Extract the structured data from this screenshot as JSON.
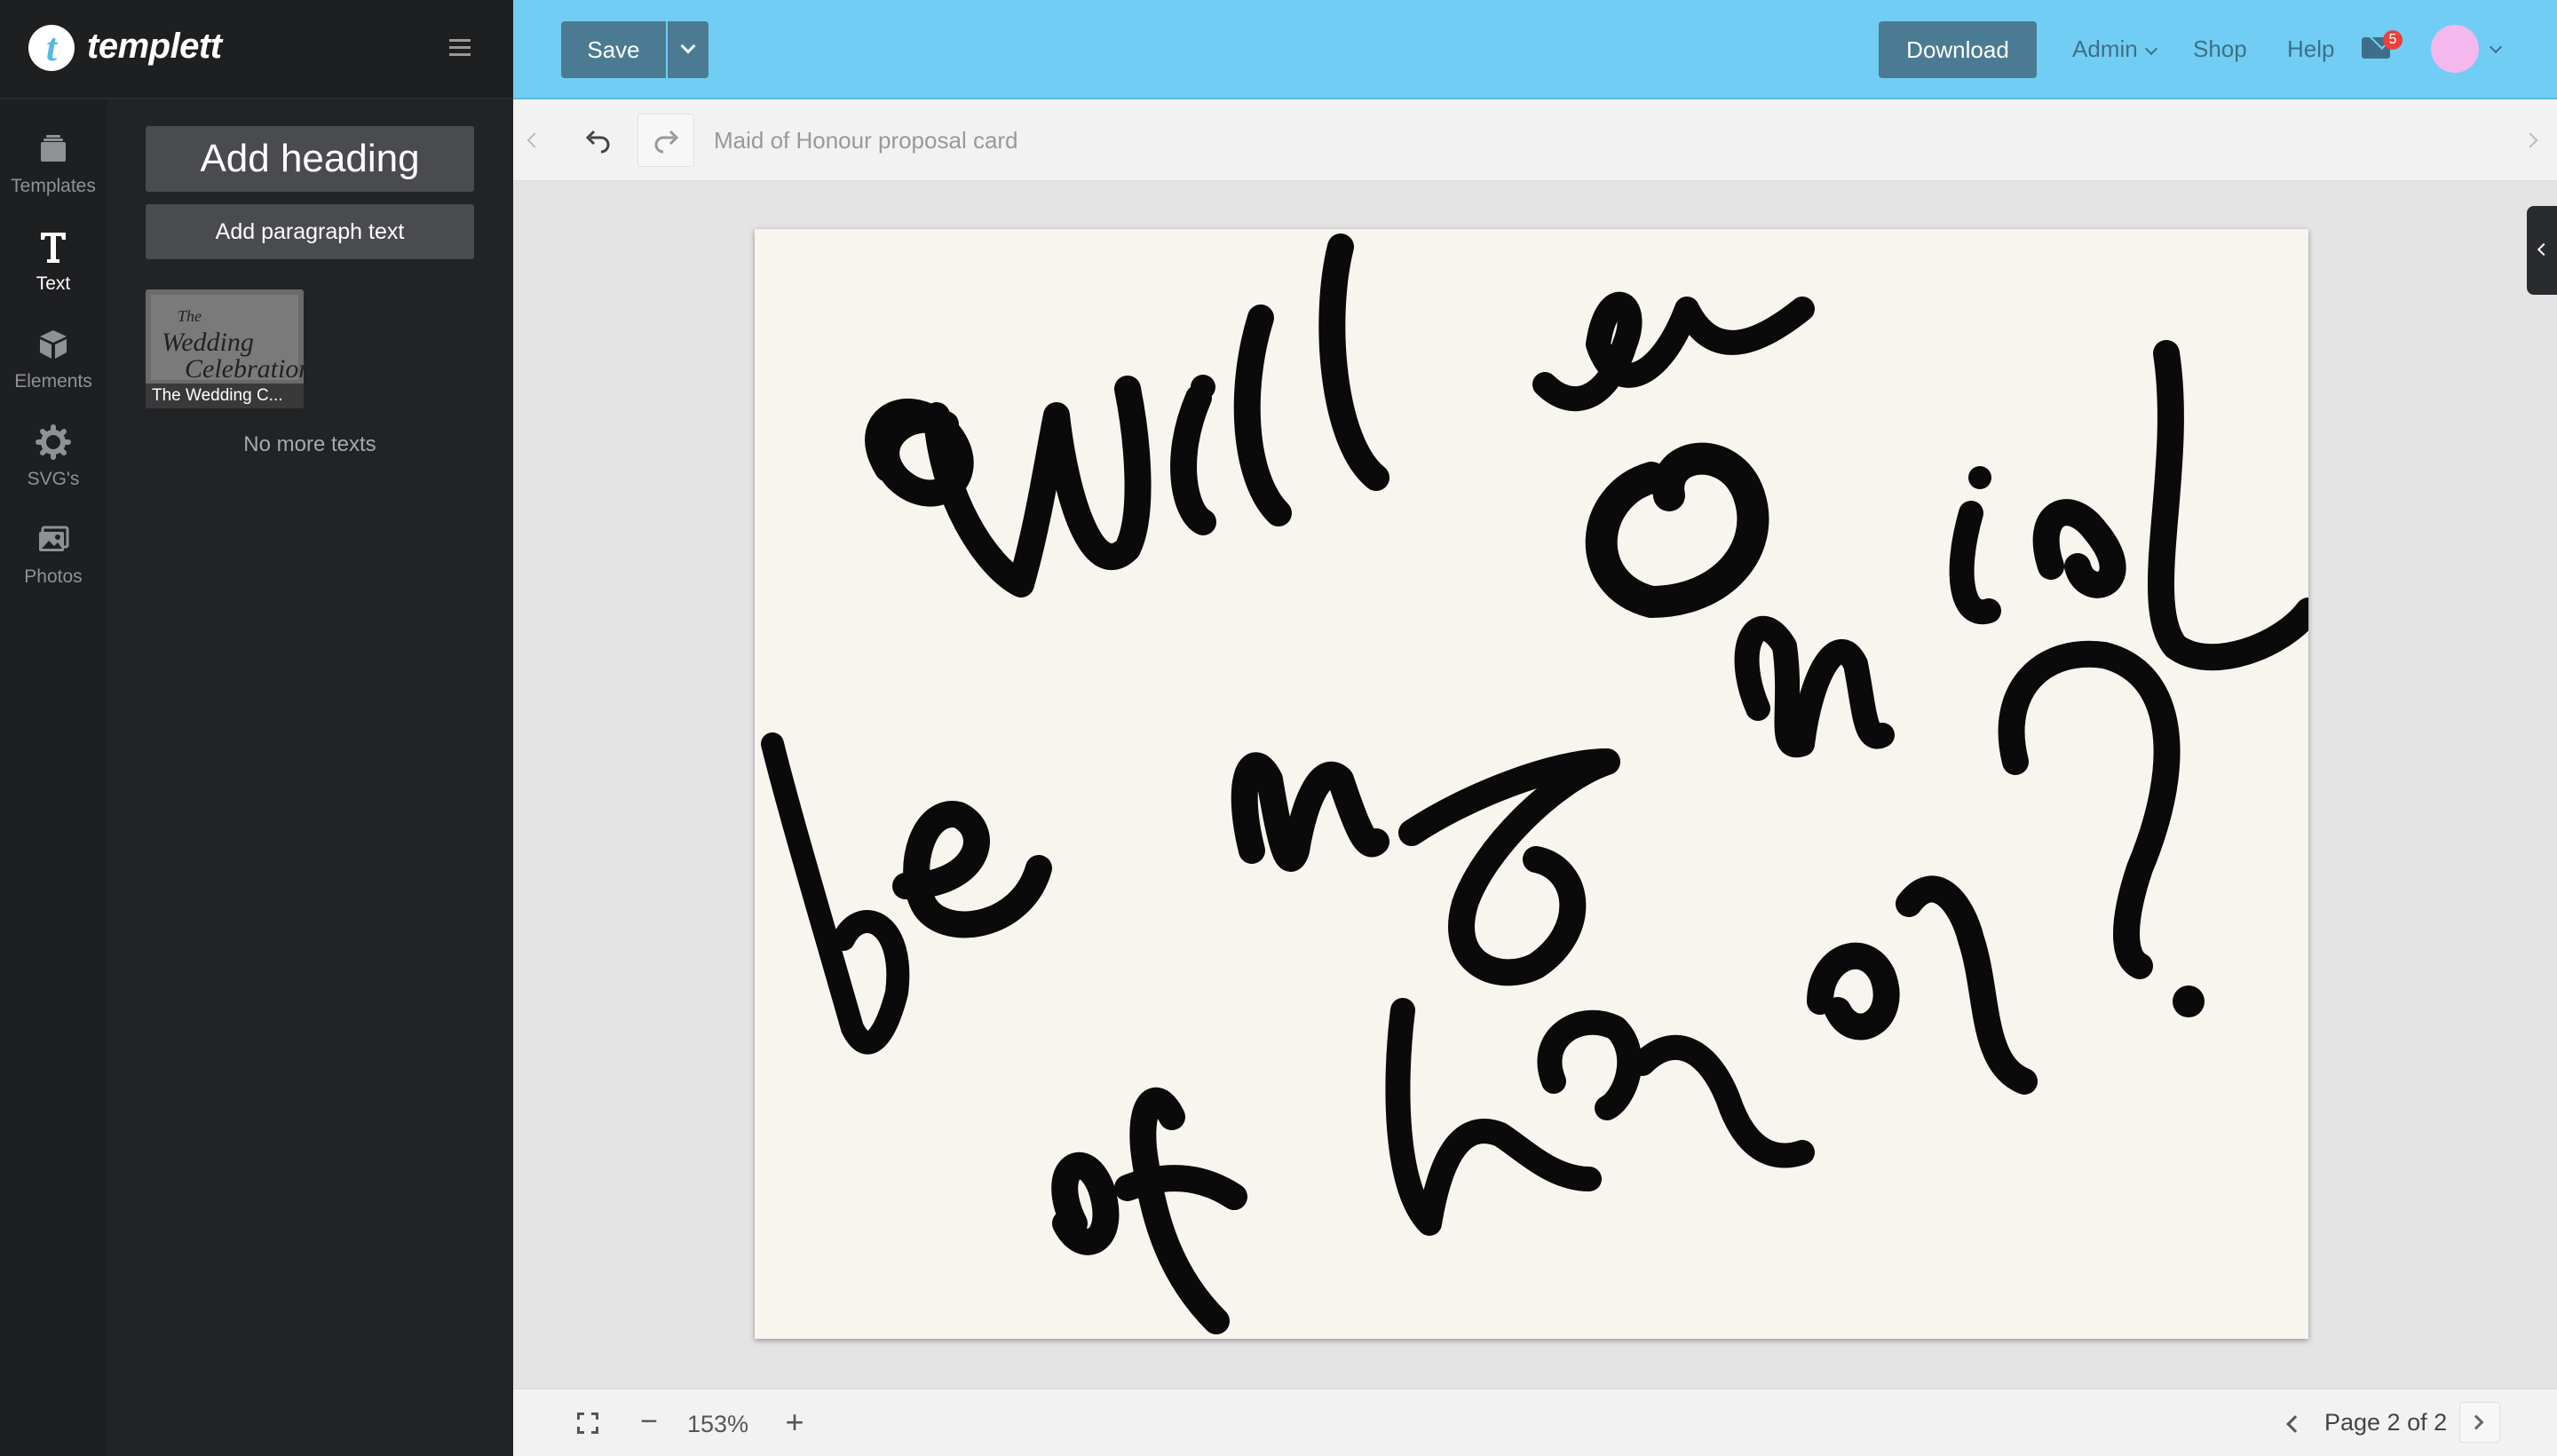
{
  "app": {
    "logo_letter": "t",
    "logo_text": "templett"
  },
  "rail": {
    "items": [
      {
        "label": "Templates",
        "icon": "templates-icon"
      },
      {
        "label": "Text",
        "icon": "text-icon"
      },
      {
        "label": "Elements",
        "icon": "elements-icon"
      },
      {
        "label": "SVG's",
        "icon": "gear-icon"
      },
      {
        "label": "Photos",
        "icon": "photos-icon"
      }
    ],
    "active": "Text"
  },
  "panel": {
    "add_heading": "Add heading",
    "add_paragraph": "Add paragraph text",
    "thumbnail": {
      "art_line1": "The",
      "art_line2": "Wedding",
      "art_line3": "Celebration",
      "caption": "The Wedding C..."
    },
    "empty_message": "No more texts"
  },
  "topbar": {
    "save_label": "Save",
    "download_label": "Download",
    "links": [
      "Admin",
      "Shop",
      "Help"
    ],
    "mail_badge": "5",
    "colors": {
      "bar": "#72cdf4",
      "button": "#4a7b93",
      "link": "#3e6f88",
      "avatar": "#f4b7ee",
      "badge": "#e8423b"
    }
  },
  "toolbar": {
    "document_title": "Maid of Honour proposal card"
  },
  "canvas": {
    "background": "#f8f4ee",
    "lettering": "Will you be my maid of honor?"
  },
  "bottombar": {
    "zoom": "153%",
    "zoom_minus": "−",
    "zoom_plus": "+",
    "page_label": "Page 2 of 2"
  }
}
